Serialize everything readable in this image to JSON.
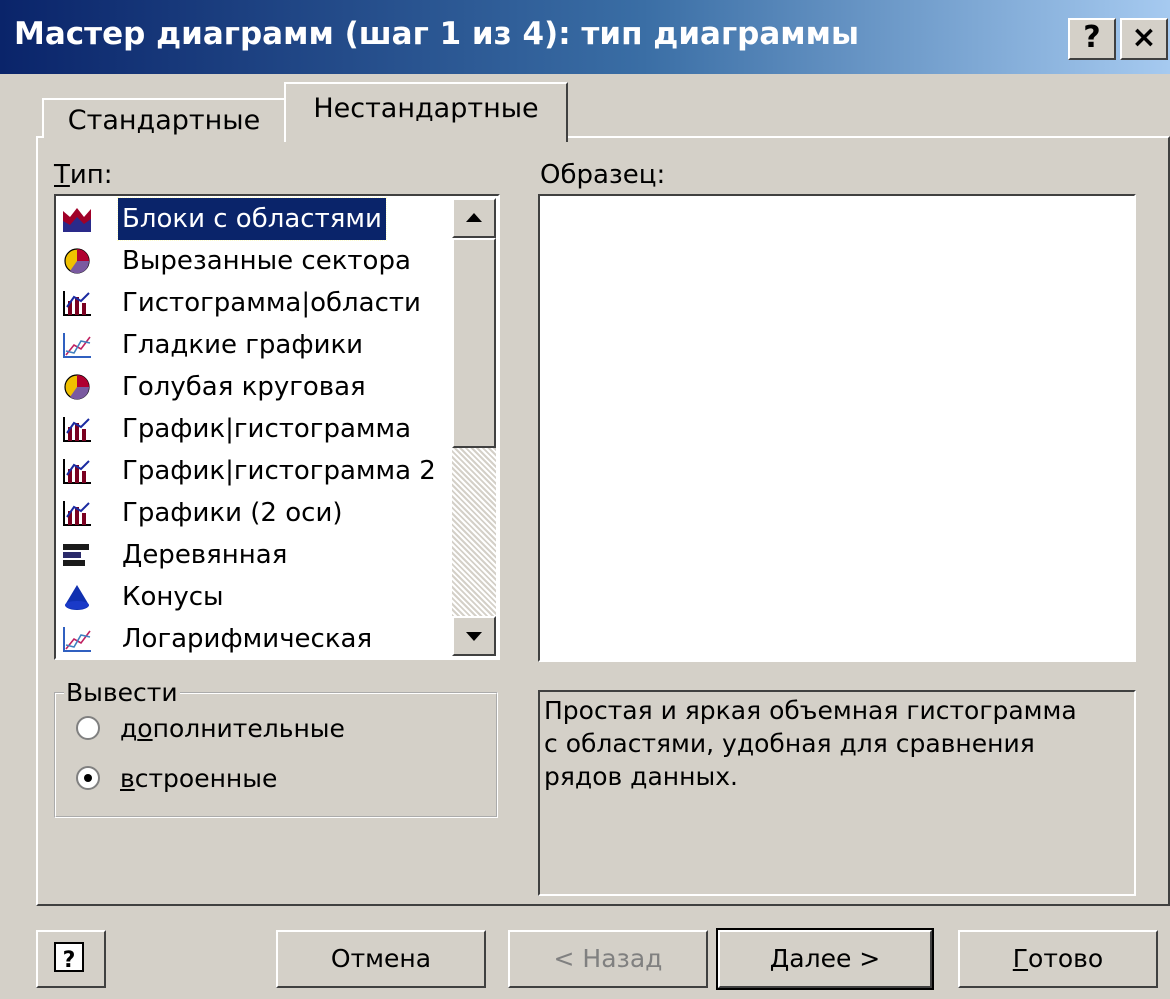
{
  "window": {
    "title": "Мастер диаграмм (шаг 1 из 4): тип диаграммы",
    "help_button": "?",
    "close_button": "×"
  },
  "tabs": [
    {
      "label": "Стандартные",
      "active": false
    },
    {
      "label": "Нестандартные",
      "active": true
    }
  ],
  "type_label": "Тип:",
  "sample_label": "Образец:",
  "chart_types": [
    {
      "label": "Блоки с областями",
      "icon": "area-blocks-icon",
      "selected": true
    },
    {
      "label": "Вырезанные сектора",
      "icon": "pie-icon"
    },
    {
      "label": "Гистограмма|области",
      "icon": "bar-line-icon"
    },
    {
      "label": "Гладкие графики",
      "icon": "line-icon"
    },
    {
      "label": "Голубая круговая",
      "icon": "pie-icon"
    },
    {
      "label": "График|гистограмма",
      "icon": "bar-line-icon"
    },
    {
      "label": "График|гистограмма 2",
      "icon": "bar-line-icon"
    },
    {
      "label": "Графики (2 оси)",
      "icon": "bar-line-icon"
    },
    {
      "label": "Деревянная",
      "icon": "horizontal-bars-icon"
    },
    {
      "label": "Конусы",
      "icon": "cone-icon"
    },
    {
      "label": "Логарифмическая",
      "icon": "line-icon"
    }
  ],
  "output_group": {
    "title": "Вывести",
    "options": [
      {
        "label": "дополнительные",
        "checked": false
      },
      {
        "label": "встроенные",
        "checked": true
      }
    ]
  },
  "description": "Простая и яркая объемная гистограмма\nс областями, удобная для сравнения\nрядов данных.",
  "buttons": {
    "help": "?",
    "cancel": "Отмена",
    "back": "< Назад",
    "next": "Далее >",
    "finish": "Готово"
  },
  "colors": {
    "titlebar_start": "#0a246a",
    "titlebar_end": "#a6caf0",
    "dialog_bg": "#d4d0c8",
    "selection": "#0a246a"
  }
}
